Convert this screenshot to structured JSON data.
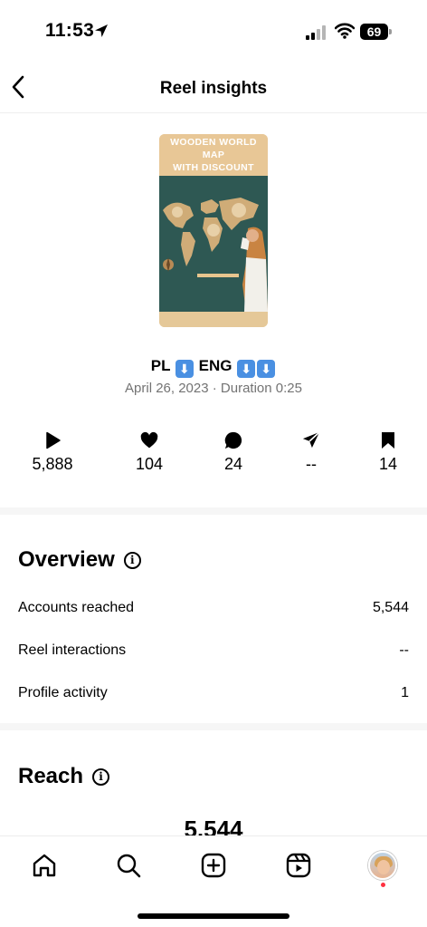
{
  "status_bar": {
    "time": "11:53",
    "battery": "69"
  },
  "header": {
    "title": "Reel insights"
  },
  "reel": {
    "thumbnail_text_line1": "WOODEN WORLD MAP",
    "thumbnail_text_line2": "WITH DISCOUNT",
    "caption_pl": "PL",
    "caption_eng": "ENG",
    "caption_arrow": "⬇",
    "meta": "April 26, 2023 · Duration 0:25"
  },
  "stats": [
    {
      "icon": "play-icon",
      "value": "5,888"
    },
    {
      "icon": "heart-icon",
      "value": "104"
    },
    {
      "icon": "comment-icon",
      "value": "24"
    },
    {
      "icon": "share-icon",
      "value": "--"
    },
    {
      "icon": "bookmark-icon",
      "value": "14"
    }
  ],
  "overview": {
    "title": "Overview",
    "rows": [
      {
        "label": "Accounts reached",
        "value": "5,544"
      },
      {
        "label": "Reel interactions",
        "value": "--"
      },
      {
        "label": "Profile activity",
        "value": "1"
      }
    ]
  },
  "reach": {
    "title": "Reach",
    "value": "5,544"
  },
  "nav": [
    "home-icon",
    "search-icon",
    "create-icon",
    "reels-icon",
    "profile-avatar"
  ]
}
